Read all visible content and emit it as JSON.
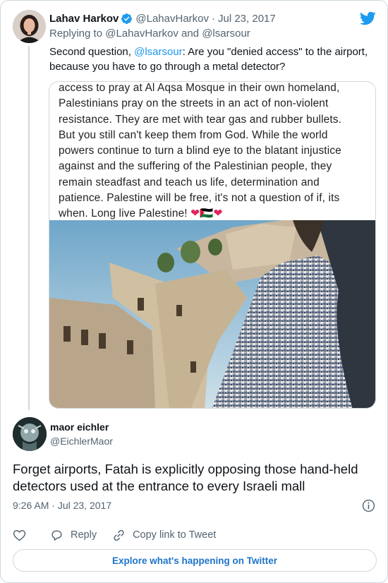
{
  "parent_tweet": {
    "name": "Lahav Harkov",
    "handle": "@LahavHarkov",
    "separator": "·",
    "date": "Jul 23, 2017",
    "replying_prefix": "Replying to",
    "replying_user1": "@LahavHarkov",
    "replying_and": "and",
    "replying_user2": "@lsarsour",
    "text_before": "Second question,",
    "text_mention": "@lsarsour",
    "text_after": ": Are you \"denied access\" to the airport, because you have to go through a metal detector?",
    "media_caption_lines": [
      "access to pray at Al Aqsa Mosque in their own homeland,",
      "Palestinians pray on the streets in an act of non-violent",
      "resistance. They are met with tear gas and rubber bullets.",
      "But you still can't keep them from God. While the world",
      "powers continue to turn a blind eye to the blatant injustice",
      "against and the suffering of the Palestinian people, they",
      "remain steadfast and teach us life, determination and",
      "patience. Palestine will be free, it's not a question of if, its",
      "when. Long live Palestine!"
    ],
    "media_emoji": "❤🇵🇸❤"
  },
  "main_tweet": {
    "name": "maor eichler",
    "handle": "@EichlerMaor",
    "text": "Forget airports, Fatah is explicitly opposing those hand-held detectors used at the entrance to every Israeli mall",
    "time": "9:26 AM",
    "separator": "·",
    "date": "Jul 23, 2017"
  },
  "actions": {
    "reply_label": "Reply",
    "copy_label": "Copy link to Tweet"
  },
  "explore_label": "Explore what's happening on Twitter",
  "colors": {
    "accent": "#1d9bf0",
    "secondary_text": "#536471",
    "border": "#cfd9de"
  }
}
